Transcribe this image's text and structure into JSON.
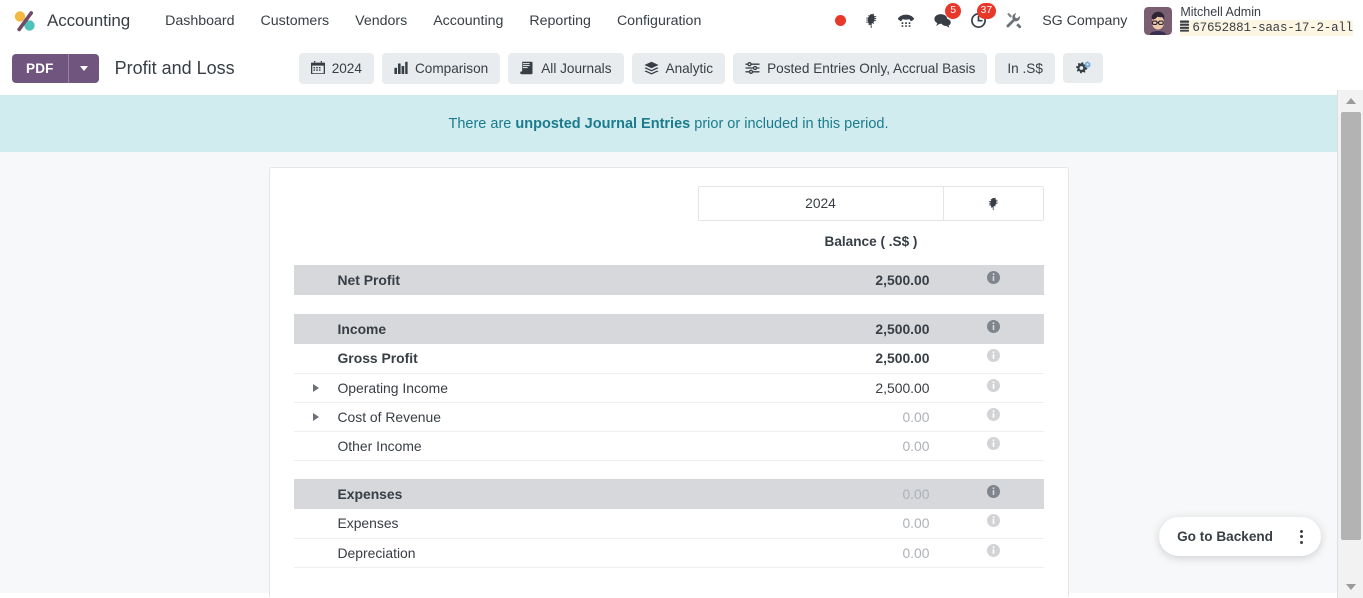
{
  "navbar": {
    "brand": "Accounting",
    "brand_logo_icon": "odoo-accounting-percent-logo",
    "menu": [
      {
        "label": "Dashboard",
        "name": "nav-dashboard"
      },
      {
        "label": "Customers",
        "name": "nav-customers"
      },
      {
        "label": "Vendors",
        "name": "nav-vendors"
      },
      {
        "label": "Accounting",
        "name": "nav-accounting"
      },
      {
        "label": "Reporting",
        "name": "nav-reporting"
      },
      {
        "label": "Configuration",
        "name": "nav-configuration"
      }
    ],
    "sys_icons": [
      {
        "name": "recording-dot-icon",
        "glyph": "record"
      },
      {
        "name": "bug-icon",
        "glyph": "bug"
      },
      {
        "name": "voip-phone-icon",
        "glyph": "phone"
      },
      {
        "name": "messages-icon",
        "glyph": "chat",
        "badge": "5"
      },
      {
        "name": "activities-clock-icon",
        "glyph": "clock",
        "badge": "37"
      },
      {
        "name": "developer-tools-icon",
        "glyph": "wrench"
      }
    ],
    "company": "SG Company",
    "user_name": "Mitchell Admin",
    "database": "67652881-saas-17-2-all",
    "database_icon": "database-icon",
    "avatar_name": "user-avatar"
  },
  "control_panel": {
    "pdf_label": "PDF",
    "pdf_dropdown_icon": "chevron-down-icon",
    "report_title": "Profit and Loss",
    "filters": [
      {
        "label": "2024",
        "icon": "calendar-icon",
        "name": "filter-date-2024"
      },
      {
        "label": "Comparison",
        "icon": "bar-chart-icon",
        "name": "filter-comparison"
      },
      {
        "label": "All Journals",
        "icon": "book-icon",
        "name": "filter-journals"
      },
      {
        "label": "Analytic",
        "icon": "layers-icon",
        "name": "filter-analytic"
      },
      {
        "label": "Posted Entries Only, Accrual Basis",
        "icon": "sliders-icon",
        "name": "filter-options"
      },
      {
        "label": "In .S$",
        "icon": "",
        "name": "filter-currency"
      }
    ],
    "settings_icon": "gears-icon",
    "settings_name": "report-settings-button"
  },
  "alert": {
    "text_before": "There are ",
    "bold": "unposted Journal Entries",
    "text_after": " prior or included in this period."
  },
  "report": {
    "column_header_year": "2024",
    "column_header_bug_icon": "bug-icon",
    "balance_label": "Balance ( .S$ )",
    "info_icon": "info-icon",
    "expand_icon": "caret-right-icon",
    "rows": [
      {
        "label": "Net Profit",
        "value": "2,500.00",
        "type": "section",
        "level": 0,
        "expandable": false,
        "muted": false
      },
      {
        "label": "",
        "value": "",
        "type": "spacer",
        "level": 0,
        "expandable": false,
        "muted": false
      },
      {
        "label": "Income",
        "value": "2,500.00",
        "type": "section",
        "level": 0,
        "expandable": false,
        "muted": false
      },
      {
        "label": "Gross Profit",
        "value": "2,500.00",
        "type": "line",
        "level": 1,
        "expandable": false,
        "muted": false
      },
      {
        "label": "Operating Income",
        "value": "2,500.00",
        "type": "line",
        "level": 3,
        "expandable": true,
        "muted": false
      },
      {
        "label": "Cost of Revenue",
        "value": "0.00",
        "type": "line",
        "level": 3,
        "expandable": true,
        "muted": true
      },
      {
        "label": "Other Income",
        "value": "0.00",
        "type": "line",
        "level": 2,
        "expandable": false,
        "muted": true
      },
      {
        "label": "",
        "value": "",
        "type": "spacer",
        "level": 0,
        "expandable": false,
        "muted": false
      },
      {
        "label": "Expenses",
        "value": "0.00",
        "type": "section",
        "level": 0,
        "expandable": false,
        "muted": true
      },
      {
        "label": "Expenses",
        "value": "0.00",
        "type": "line",
        "level": 2,
        "expandable": false,
        "muted": true
      },
      {
        "label": "Depreciation",
        "value": "0.00",
        "type": "line",
        "level": 2,
        "expandable": false,
        "muted": true
      }
    ]
  },
  "backend_widget": {
    "label": "Go to Backend",
    "menu_icon": "kebab-menu-icon"
  },
  "colors": {
    "pdf_button": "#70567e",
    "alert_bg": "#d1ecef",
    "alert_text": "#1b7b8c",
    "section_row_bg": "#d6d8db",
    "badge_red": "#e8382a",
    "page_bg": "#f7f8f9"
  }
}
